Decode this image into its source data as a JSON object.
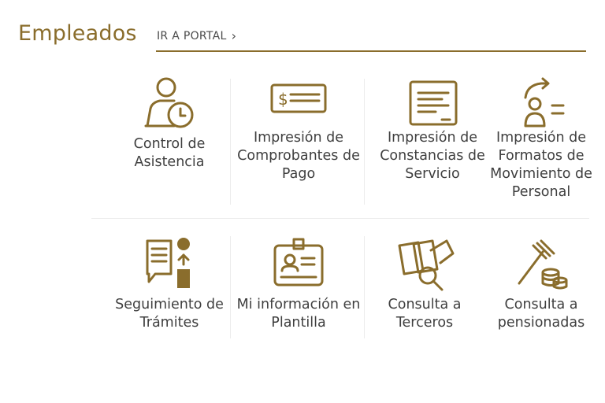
{
  "header": {
    "title": "Empleados",
    "portal_link": "IR A PORTAL",
    "portal_icon": "chevron-right-icon"
  },
  "tiles": [
    {
      "label": "Control de Asistencia",
      "icon": "employee-clock-icon"
    },
    {
      "label": "Impresión de Comprobantes de Pago",
      "icon": "check-payment-icon"
    },
    {
      "label": "Impresión de Constancias de Servicio",
      "icon": "certificate-icon"
    },
    {
      "label": "Impresión de Formatos de Movimiento de Personal",
      "icon": "person-movement-icon"
    },
    {
      "label": "Seguimiento de Trámites",
      "icon": "document-tracking-icon"
    },
    {
      "label": "Mi información en Plantilla",
      "icon": "id-badge-icon"
    },
    {
      "label": "Consulta a Terceros",
      "icon": "documents-search-icon"
    },
    {
      "label": "Consulta a pensionadas",
      "icon": "gavel-coins-icon"
    }
  ],
  "colors": {
    "accent": "#8a6d2c",
    "text": "#3f3f3f",
    "divider": "#ececec"
  }
}
